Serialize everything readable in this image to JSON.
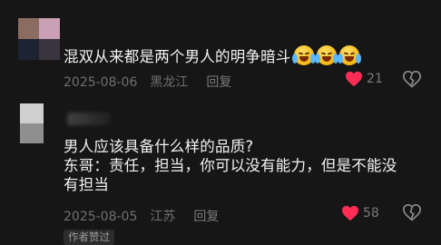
{
  "comments": [
    {
      "text": "混双从来都是两个男人的明争暗斗",
      "emojis": [
        "sob-laugh-emoji",
        "sob-laugh-emoji",
        "sob-laugh-emoji"
      ],
      "date": "2025-08-06",
      "location": "黑龙江",
      "reply_label": "回复",
      "likes": "21",
      "liked": true
    },
    {
      "lines": [
        "男人应该具备什么样的品质?",
        "东哥：责任，担当，你可以没有能力，但是不能没",
        "有担当"
      ],
      "date": "2025-08-05",
      "location": "江苏",
      "reply_label": "回复",
      "likes": "58",
      "liked": true,
      "badge": "作者赞过"
    }
  ],
  "colors": {
    "background": "#161616",
    "heart": "#ff2d55",
    "meta": "#6f6f6f"
  }
}
